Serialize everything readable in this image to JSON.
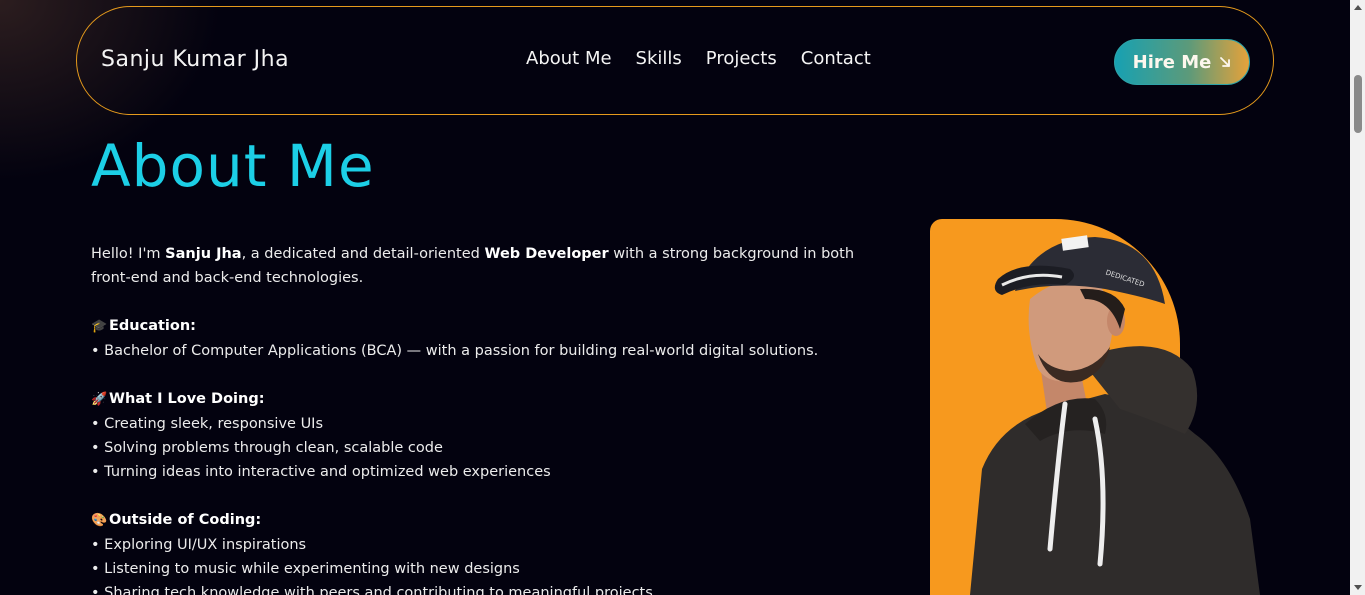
{
  "nav": {
    "brand": "Sanju Kumar Jha",
    "links": [
      {
        "label": "About Me"
      },
      {
        "label": "Skills"
      },
      {
        "label": "Projects"
      },
      {
        "label": "Contact"
      }
    ],
    "hire_label": "Hire Me",
    "hire_icon": "arrow-down-right-icon"
  },
  "about": {
    "title": "About Me",
    "intro_pre": "Hello! I'm ",
    "intro_name": "Sanju Jha",
    "intro_mid": ", a dedicated and detail-oriented ",
    "intro_role": "Web Developer",
    "intro_post": " with a strong background in both front-end and back-end technologies.",
    "education": {
      "icon": "🎓",
      "heading": "Education:",
      "items": [
        "• Bachelor of Computer Applications (BCA) — with a passion for building real-world digital solutions."
      ]
    },
    "love": {
      "icon": "🚀",
      "heading": "What I Love Doing:",
      "items": [
        "• Creating sleek, responsive UIs",
        "• Solving problems through clean, scalable code",
        "• Turning ideas into interactive and optimized web experiences"
      ]
    },
    "outside": {
      "icon": "🎨",
      "heading": "Outside of Coding:",
      "items": [
        "• Exploring UI/UX inspirations",
        "• Listening to music while experimenting with new designs",
        "• Sharing tech knowledge with peers and contributing to meaningful projects"
      ]
    }
  },
  "colors": {
    "accent_cyan": "#1ccfe6",
    "accent_orange": "#f7991e",
    "background": "#03020f"
  }
}
